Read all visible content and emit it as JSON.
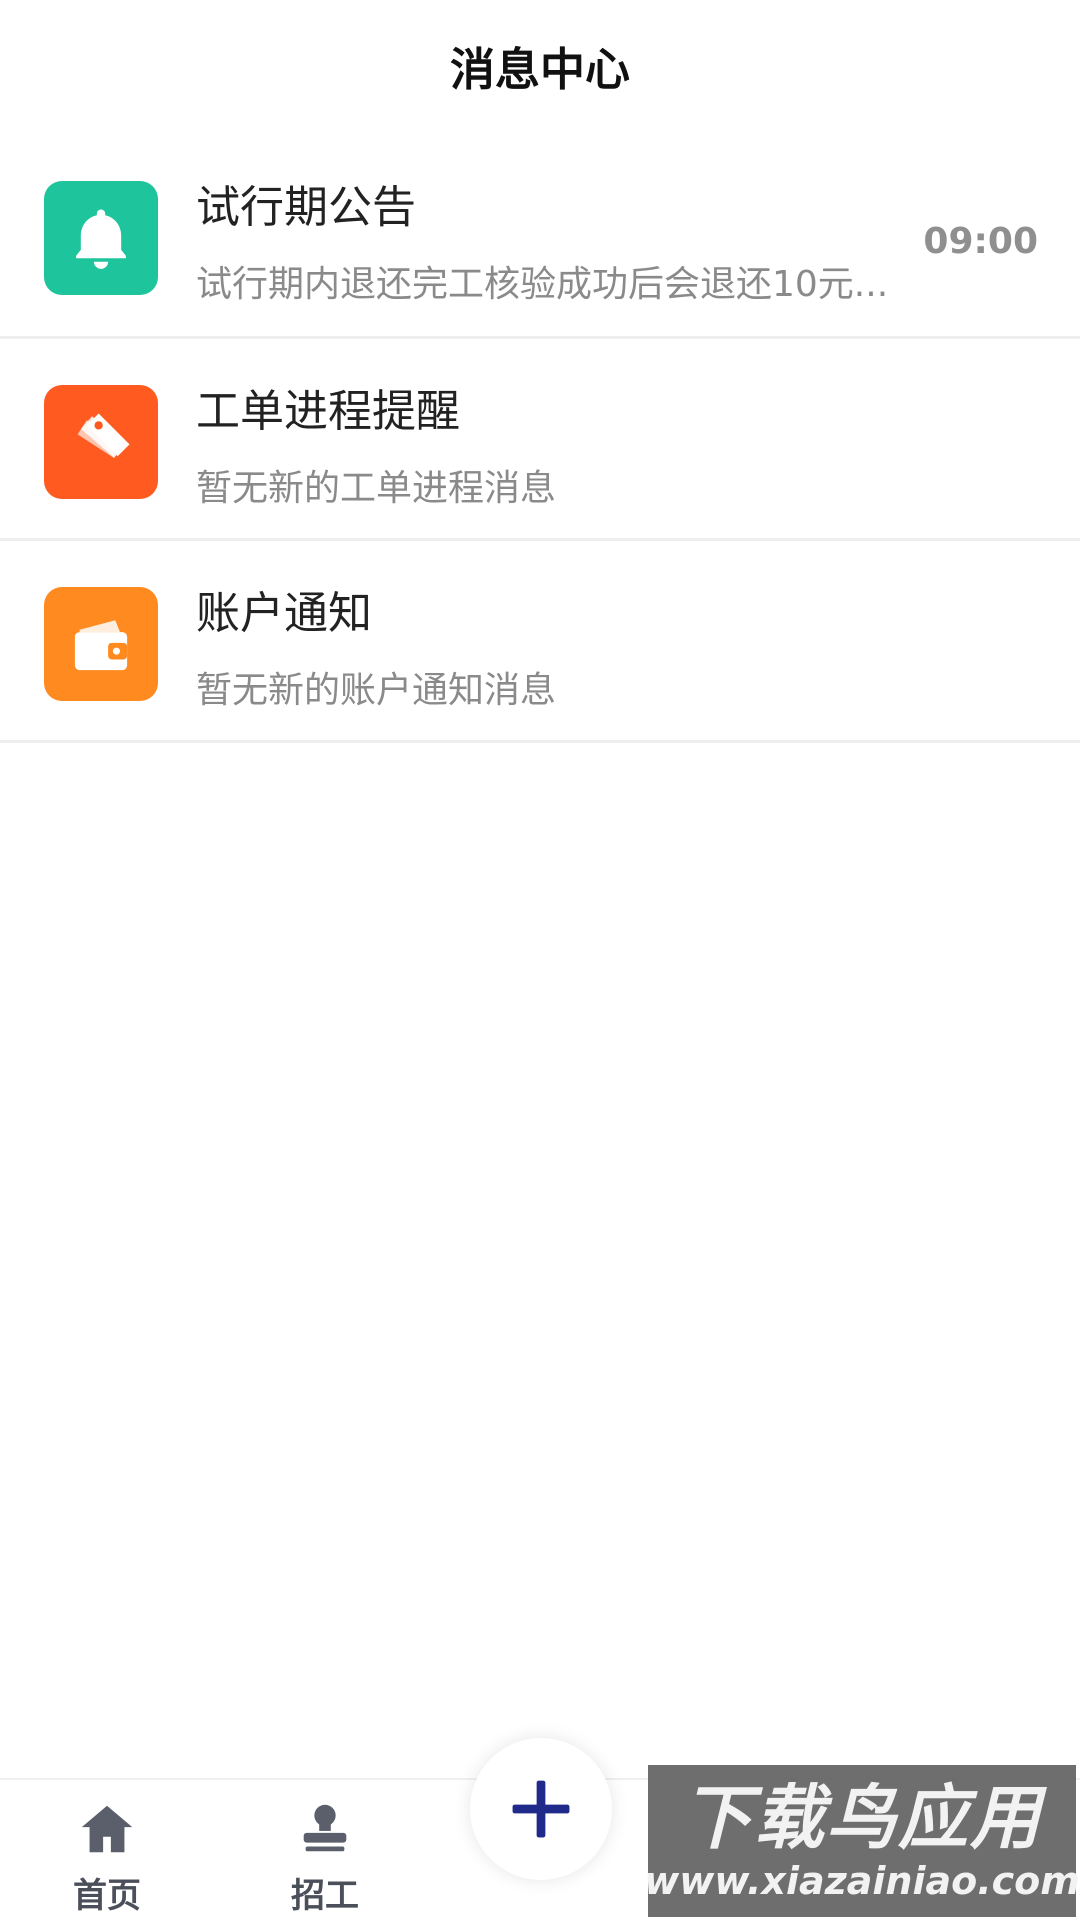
{
  "header": {
    "title": "消息中心"
  },
  "messages": [
    {
      "title": "试行期公告",
      "subtitle": "试行期内退还完工核验成功后会退还10元...",
      "time": "09:00",
      "icon": "bell-icon",
      "color": "#1dc49c"
    },
    {
      "title": "工单进程提醒",
      "subtitle": "暂无新的工单进程消息",
      "time": "",
      "icon": "tags-icon",
      "color": "#ff5a1f"
    },
    {
      "title": "账户通知",
      "subtitle": "暂无新的账户通知消息",
      "time": "",
      "icon": "wallet-icon",
      "color": "#ff8a1f"
    }
  ],
  "tabbar": {
    "tabs": [
      {
        "label": "首页",
        "icon": "home-icon"
      },
      {
        "label": "招工",
        "icon": "stamp-icon"
      }
    ],
    "fab_icon": "plus-icon",
    "fab_color": "#1f2a8a"
  },
  "watermark": {
    "title": "下载鸟应用",
    "url": "www.xiazainiao.com"
  }
}
